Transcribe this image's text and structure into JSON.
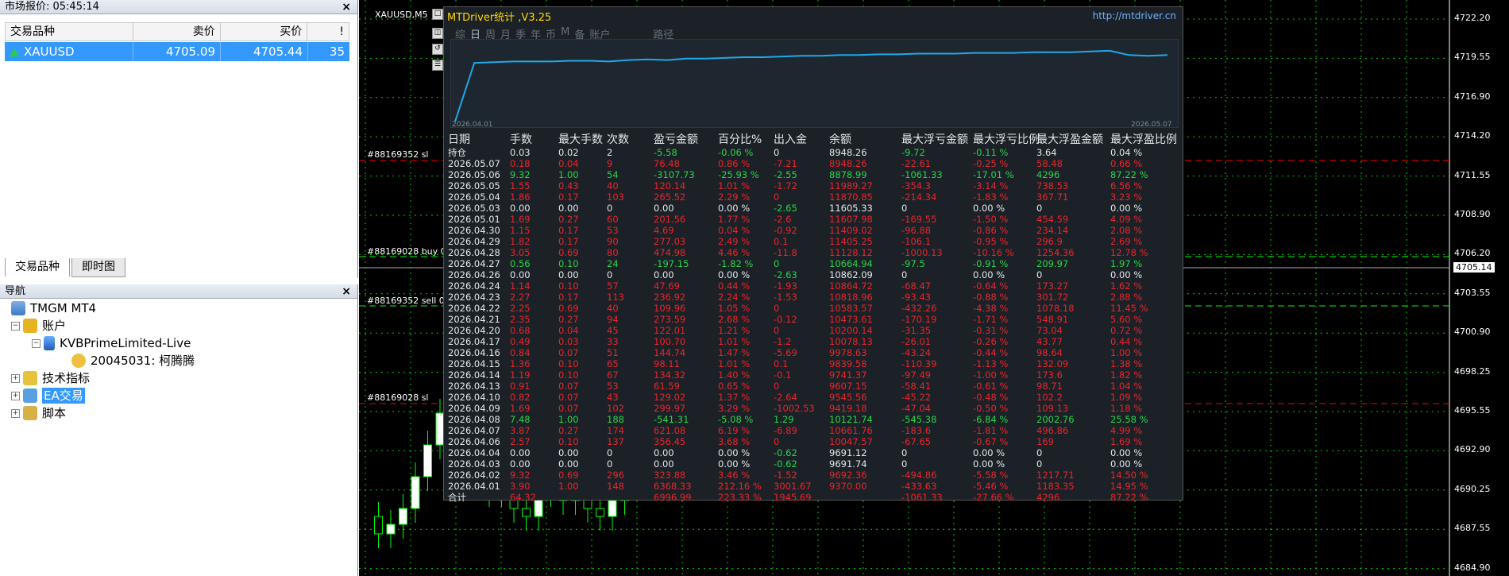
{
  "market_watch": {
    "title": "市场报价: 05:45:14",
    "headers": [
      "交易品种",
      "卖价",
      "买价",
      "!"
    ],
    "rows": [
      {
        "symbol": "XAUUSD",
        "bid": "4705.09",
        "ask": "4705.44",
        "spread": "35"
      }
    ],
    "tabs": [
      "交易品种",
      "即时图"
    ]
  },
  "navigator": {
    "title": "导航",
    "items": [
      "TMGM MT4",
      "账户",
      "KVBPrimeLimited-Live",
      "20045031: 柯腾腾",
      "技术指标",
      "EA交易",
      "脚本"
    ]
  },
  "chart": {
    "title": "XAUUSD,M5",
    "current_price": "4705.14",
    "price_labels": [
      "4722.20",
      "4719.55",
      "4716.90",
      "4714.20",
      "4711.55",
      "4708.90",
      "4706.20",
      "4703.55",
      "4700.90",
      "4698.25",
      "4695.55",
      "4692.90",
      "4690.25",
      "4687.55",
      "4684.90"
    ],
    "order_labels": [
      "#88169352 sl",
      "#88169028 buy 0",
      "#88169352 sell 0",
      "#88169028 sl"
    ],
    "colors": {
      "bg": "#000000",
      "bull": "#00ff00",
      "bear": "#ffffff",
      "grid": "#00ff00",
      "sl_line": "#ff0000"
    }
  },
  "ea": {
    "title": "MTDriver统计 ,V3.25",
    "url": "http://mtdriver.cn",
    "tabs": [
      "综",
      "日",
      "周",
      "月",
      "季",
      "年",
      "币",
      "M",
      "备",
      "账户",
      "路径"
    ],
    "active_tab": "日",
    "chart_start": "2026.04.01",
    "chart_end": "2026.05.07",
    "equity_curve": [
      0.0,
      0.82,
      0.83,
      0.84,
      0.84,
      0.84,
      0.85,
      0.85,
      0.84,
      0.86,
      0.87,
      0.86,
      0.88,
      0.88,
      0.89,
      0.9,
      0.9,
      0.91,
      0.92,
      0.92,
      0.93,
      0.93,
      0.94,
      0.94,
      0.95,
      0.95,
      0.95,
      0.96,
      0.96,
      0.96,
      0.97,
      0.97,
      0.97,
      0.98,
      0.99,
      0.93,
      0.92,
      0.93
    ],
    "headers": [
      "日期",
      "手数",
      "最大手数",
      "次数",
      "盈亏金额",
      "百分比%",
      "出入金",
      "余额",
      "最大浮亏金额",
      "最大浮亏比例",
      "最大浮盈金额",
      "最大浮盈比例"
    ],
    "rows": [
      {
        "c": [
          "持仓",
          "0.03",
          "0.02",
          "2",
          "-5.58",
          "-0.06 %",
          "0",
          "8948.26",
          "-9.72",
          "-0.11 %",
          "3.64",
          "0.04 %"
        ],
        "s": "w"
      },
      {
        "c": [
          "2026.05.07",
          "0.18",
          "0.04",
          "9",
          "76.48",
          "0.86 %",
          "-7.21",
          "8948.26",
          "-22.61",
          "-0.25 %",
          "58.48",
          "0.66 %"
        ],
        "s": "r"
      },
      {
        "c": [
          "2026.05.06",
          "9.32",
          "1.00",
          "54",
          "-3107.73",
          "-25.93 %",
          "-2.55",
          "8878.99",
          "-1061.33",
          "-17.01 %",
          "4296",
          "87.22 %"
        ],
        "s": "g"
      },
      {
        "c": [
          "2026.05.05",
          "1.55",
          "0.43",
          "40",
          "120.14",
          "1.01 %",
          "-1.72",
          "11989.27",
          "-354.3",
          "-3.14 %",
          "738.53",
          "6.56 %"
        ],
        "s": "r"
      },
      {
        "c": [
          "2026.05.04",
          "1.86",
          "0.17",
          "103",
          "265.52",
          "2.29 %",
          "0",
          "11870.85",
          "-214.34",
          "-1.83 %",
          "367.71",
          "3.23 %"
        ],
        "s": "r"
      },
      {
        "c": [
          "2026.05.03",
          "0.00",
          "0.00",
          "0",
          "0.00",
          "0.00 %",
          "-2.65",
          "11605.33",
          "0",
          "0.00 %",
          "0",
          "0.00 %"
        ],
        "s": "w"
      },
      {
        "c": [
          "2026.05.01",
          "1.69",
          "0.27",
          "60",
          "201.56",
          "1.77 %",
          "-2.6",
          "11607.98",
          "-169.55",
          "-1.50 %",
          "454.59",
          "4.09 %"
        ],
        "s": "r"
      },
      {
        "c": [
          "2026.04.30",
          "1.15",
          "0.17",
          "53",
          "4.69",
          "0.04 %",
          "-0.92",
          "11409.02",
          "-96.88",
          "-0.86 %",
          "234.14",
          "2.08 %"
        ],
        "s": "r"
      },
      {
        "c": [
          "2026.04.29",
          "1.82",
          "0.17",
          "90",
          "277.03",
          "2.49 %",
          "0.1",
          "11405.25",
          "-106.1",
          "-0.95 %",
          "296.9",
          "2.69 %"
        ],
        "s": "r"
      },
      {
        "c": [
          "2026.04.28",
          "3.05",
          "0.69",
          "80",
          "474.98",
          "4.46 %",
          "-11.8",
          "11128.12",
          "-1000.13",
          "-10.16 %",
          "1254.36",
          "12.78 %"
        ],
        "s": "r"
      },
      {
        "c": [
          "2026.04.27",
          "0.56",
          "0.10",
          "24",
          "-197.15",
          "-1.82 %",
          "0",
          "10664.94",
          "-97.5",
          "-0.91 %",
          "209.97",
          "1.97 %"
        ],
        "s": "g"
      },
      {
        "c": [
          "2026.04.26",
          "0.00",
          "0.00",
          "0",
          "0.00",
          "0.00 %",
          "-2.63",
          "10862.09",
          "0",
          "0.00 %",
          "0",
          "0.00 %"
        ],
        "s": "w"
      },
      {
        "c": [
          "2026.04.24",
          "1.14",
          "0.10",
          "57",
          "47.69",
          "0.44 %",
          "-1.93",
          "10864.72",
          "-68.47",
          "-0.64 %",
          "173.27",
          "1.62 %"
        ],
        "s": "r"
      },
      {
        "c": [
          "2026.04.23",
          "2.27",
          "0.17",
          "113",
          "236.92",
          "2.24 %",
          "-1.53",
          "10818.96",
          "-93.43",
          "-0.88 %",
          "301.72",
          "2.88 %"
        ],
        "s": "r"
      },
      {
        "c": [
          "2026.04.22",
          "2.25",
          "0.69",
          "40",
          "109.96",
          "1.05 %",
          "0",
          "10583.57",
          "-432.26",
          "-4.38 %",
          "1078.18",
          "11.45 %"
        ],
        "s": "r"
      },
      {
        "c": [
          "2026.04.21",
          "2.35",
          "0.27",
          "94",
          "273.59",
          "2.68 %",
          "-0.12",
          "10473.61",
          "-170.19",
          "-1.71 %",
          "548.91",
          "5.60 %"
        ],
        "s": "r"
      },
      {
        "c": [
          "2026.04.20",
          "0.68",
          "0.04",
          "45",
          "122.01",
          "1.21 %",
          "0",
          "10200.14",
          "-31.35",
          "-0.31 %",
          "73.04",
          "0.72 %"
        ],
        "s": "r"
      },
      {
        "c": [
          "2026.04.17",
          "0.49",
          "0.03",
          "33",
          "100.70",
          "1.01 %",
          "-1.2",
          "10078.13",
          "-26.01",
          "-0.26 %",
          "43.77",
          "0.44 %"
        ],
        "s": "r"
      },
      {
        "c": [
          "2026.04.16",
          "0.84",
          "0.07",
          "51",
          "144.74",
          "1.47 %",
          "-5.69",
          "9978.63",
          "-43.24",
          "-0.44 %",
          "98.64",
          "1.00 %"
        ],
        "s": "r"
      },
      {
        "c": [
          "2026.04.15",
          "1.36",
          "0.10",
          "65",
          "98.11",
          "1.01 %",
          "0.1",
          "9839.58",
          "-110.39",
          "-1.13 %",
          "132.09",
          "1.38 %"
        ],
        "s": "r"
      },
      {
        "c": [
          "2026.04.14",
          "1.19",
          "0.10",
          "67",
          "134.32",
          "1.40 %",
          "-0.1",
          "9741.37",
          "-97.49",
          "-1.00 %",
          "173.6",
          "1.82 %"
        ],
        "s": "r"
      },
      {
        "c": [
          "2026.04.13",
          "0.91",
          "0.07",
          "53",
          "61.59",
          "0.65 %",
          "0",
          "9607.15",
          "-58.41",
          "-0.61 %",
          "98.71",
          "1.04 %"
        ],
        "s": "r"
      },
      {
        "c": [
          "2026.04.10",
          "0.82",
          "0.07",
          "43",
          "129.02",
          "1.37 %",
          "-2.64",
          "9545.56",
          "-45.22",
          "-0.48 %",
          "102.2",
          "1.09 %"
        ],
        "s": "r"
      },
      {
        "c": [
          "2026.04.09",
          "1.69",
          "0.07",
          "102",
          "299.97",
          "3.29 %",
          "-1002.53",
          "9419.18",
          "-47.04",
          "-0.50 %",
          "109.13",
          "1.18 %"
        ],
        "s": "r"
      },
      {
        "c": [
          "2026.04.08",
          "7.48",
          "1.00",
          "188",
          "-541.31",
          "-5.08 %",
          "1.29",
          "10121.74",
          "-545.38",
          "-6.84 %",
          "2002.76",
          "25.58 %"
        ],
        "s": "g"
      },
      {
        "c": [
          "2026.04.07",
          "3.87",
          "0.27",
          "174",
          "621.08",
          "6.19 %",
          "-6.89",
          "10661.76",
          "-183.6",
          "-1.81 %",
          "496.86",
          "4.99 %"
        ],
        "s": "r"
      },
      {
        "c": [
          "2026.04.06",
          "2.57",
          "0.10",
          "137",
          "356.45",
          "3.68 %",
          "0",
          "10047.57",
          "-67.65",
          "-0.67 %",
          "169",
          "1.69 %"
        ],
        "s": "r"
      },
      {
        "c": [
          "2026.04.04",
          "0.00",
          "0.00",
          "0",
          "0.00",
          "0.00 %",
          "-0.62",
          "9691.12",
          "0",
          "0.00 %",
          "0",
          "0.00 %"
        ],
        "s": "w"
      },
      {
        "c": [
          "2026.04.03",
          "0.00",
          "0.00",
          "0",
          "0.00",
          "0.00 %",
          "-0.62",
          "9691.74",
          "0",
          "0.00 %",
          "0",
          "0.00 %"
        ],
        "s": "w"
      },
      {
        "c": [
          "2026.04.02",
          "9.32",
          "0.69",
          "296",
          "323.88",
          "3.46 %",
          "-1.52",
          "9692.36",
          "-494.86",
          "-5.58 %",
          "1217.71",
          "14.50 %"
        ],
        "s": "r"
      },
      {
        "c": [
          "2026.04.01",
          "3.90",
          "1.00",
          "148",
          "6368.33",
          "212.16 %",
          "3001.67",
          "9370.00",
          "-433.63",
          "-5.46 %",
          "1183.35",
          "14.95 %"
        ],
        "s": "r"
      },
      {
        "c": [
          "合计",
          "64.32",
          "",
          "",
          "6996.99",
          "223.33 %",
          "1945.69",
          "",
          "-1061.33",
          "-27.66 %",
          "4296",
          "87.22 %"
        ],
        "s": "t"
      }
    ]
  }
}
